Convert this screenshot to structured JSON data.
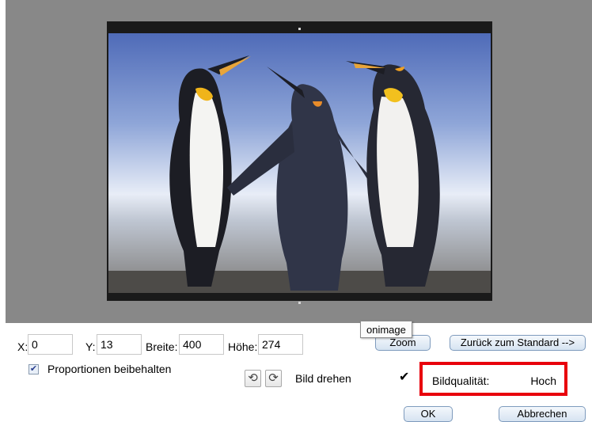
{
  "colors": {
    "preview_background": "#888888",
    "highlight_border": "#e8000c",
    "button_border": "#7e9bbd"
  },
  "crop": {
    "x_label": "X:",
    "x_value": "0",
    "y_label": "Y:",
    "y_value": "13",
    "width_label": "Breite:",
    "width_value": "400",
    "height_label": "Höhe:",
    "height_value": "274"
  },
  "buttons": {
    "zoom": "Zoom",
    "reset": "Zurück zum Standard -->",
    "ok": "OK",
    "cancel": "Abbrechen"
  },
  "tooltip": "onimage",
  "proportions": {
    "label": "Proportionen beibehalten",
    "checked": true
  },
  "rotate": {
    "label": "Bild drehen",
    "left_icon": "rotate-left-icon",
    "right_icon": "rotate-right-icon"
  },
  "quality": {
    "label": "Bildqualität:",
    "value": "Hoch"
  }
}
